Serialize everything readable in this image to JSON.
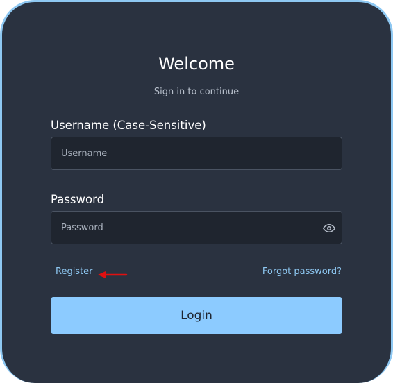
{
  "header": {
    "title": "Welcome",
    "subtitle": "Sign in to continue"
  },
  "form": {
    "username": {
      "label": "Username (Case-Sensitive)",
      "placeholder": "Username",
      "value": ""
    },
    "password": {
      "label": "Password",
      "placeholder": "Password",
      "value": "",
      "toggle_icon": "eye-icon"
    },
    "register_link": "Register",
    "forgot_link": "Forgot password?",
    "login_button": "Login"
  },
  "annotation": {
    "arrow_icon": "arrow-left-icon",
    "arrow_color": "#e01010"
  },
  "colors": {
    "card_background": "#2a3240",
    "card_border": "#8ec8f2",
    "input_background": "#1f252f",
    "link": "#8ec8f2",
    "button_background": "#8ccbff",
    "button_text": "#1f2530"
  }
}
